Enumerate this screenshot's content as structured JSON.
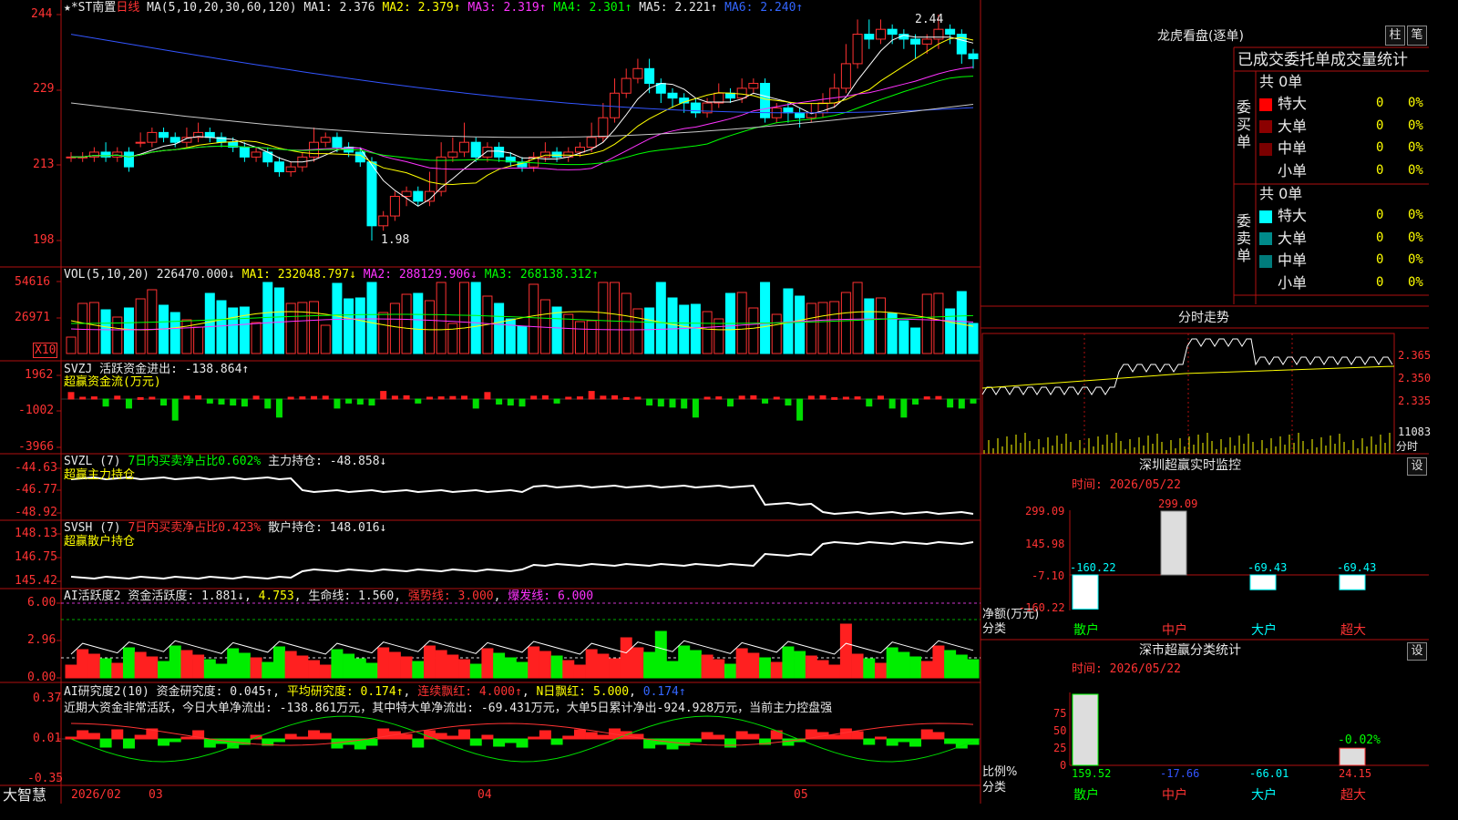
{
  "header": {
    "stock": "★*ST南置",
    "period": "日线",
    "ma_label": "MA(5,10,20,30,60,120)",
    "ma1": "MA1: 2.376",
    "ma2": "MA2: 2.379↑",
    "ma3": "MA3: 2.319↑",
    "ma4": "MA4: 2.301↑",
    "ma5": "MA5: 2.221↑",
    "ma6": "MA6: 2.240↑"
  },
  "price_axis": [
    "244",
    "229",
    "213",
    "198"
  ],
  "price_annotations": {
    "high": "2.44",
    "low": "1.98"
  },
  "volume": {
    "label": "VOL(5,10,20)",
    "value": "226470.000↓",
    "ma1": "MA1: 232048.797↓",
    "ma2": "MA2: 288129.906↓",
    "ma3": "MA3: 268138.312↑",
    "axis": [
      "54616",
      "26971"
    ],
    "unit": "X10"
  },
  "svzj": {
    "label": "SVZJ",
    "value": "活跃资金进出: -138.864↑",
    "subtitle": "超赢资金流(万元)",
    "axis": [
      "1962",
      "-1002",
      "-3966"
    ]
  },
  "svzl": {
    "label": "SVZL (7)",
    "ratio": "7日内买卖净占比0.602%",
    "value": "主力持仓: -48.858↓",
    "subtitle": "超赢主力持仓",
    "axis": [
      "-44.63",
      "-46.77",
      "-48.92"
    ]
  },
  "svsh": {
    "label": "SVSH (7)",
    "ratio": "7日内买卖净占比0.423%",
    "value": "散户持仓: 148.016↓",
    "subtitle": "超赢散户持仓",
    "axis": [
      "148.13",
      "146.75",
      "145.42"
    ]
  },
  "ai_active": {
    "label": "AI活跃度2",
    "v1": "资金活跃度: 1.881↓",
    "v2": "4.753",
    "v3": "生命线: 1.560",
    "v4": "强势线: 3.000",
    "v5": "爆发线: 6.000",
    "axis": [
      "6.00",
      "2.96",
      "0.00"
    ]
  },
  "ai_research": {
    "label": "AI研究度2(10)",
    "v1": "资金研究度: 0.045↑",
    "v2": "平均研究度: 0.174↑",
    "v3": "连续飘红: 4.000↑",
    "v4": "N日飘红: 5.000",
    "v5": "0.174↑",
    "comment": "近期大资金非常活跃，今日大单净流出: -138.861万元，其中特大单净流出: -69.431万元，大单5日累计净出-924.928万元，当前主力控盘强",
    "axis": [
      "0.37",
      "0.01",
      "-0.35"
    ]
  },
  "bottom_bar": {
    "brand": "大智慧",
    "dates": [
      "2026/02",
      "03",
      "04",
      "05"
    ]
  },
  "right_panel": {
    "dragon_title": "龙虎看盘(逐单)",
    "btn1": "柱",
    "btn2": "笔",
    "stat_title": "已成交委托单成交量统计",
    "buy_side": "委买单",
    "sell_side": "委卖单",
    "buy_total": "共 0单",
    "sell_total": "共 0单",
    "buy_rows": [
      {
        "name": "特大",
        "vol": "0",
        "pct": "0%",
        "color": "#ff0000"
      },
      {
        "name": "大单",
        "vol": "0",
        "pct": "0%",
        "color": "#8b0000"
      },
      {
        "name": "中单",
        "vol": "0",
        "pct": "0%",
        "color": "#7a0000"
      },
      {
        "name": "小单",
        "vol": "0",
        "pct": "0%",
        "color": "#000000"
      }
    ],
    "sell_rows": [
      {
        "name": "特大",
        "vol": "0",
        "pct": "0%",
        "color": "#00ffff"
      },
      {
        "name": "大单",
        "vol": "0",
        "pct": "0%",
        "color": "#008b8b"
      },
      {
        "name": "中单",
        "vol": "0",
        "pct": "0%",
        "color": "#007b7b"
      },
      {
        "name": "小单",
        "vol": "0",
        "pct": "0%",
        "color": "#000000"
      }
    ],
    "intraday_title": "分时走势",
    "intraday_axis": [
      "2.365",
      "2.350",
      "2.335"
    ],
    "intraday_vol": "11083",
    "intraday_unit": "分时",
    "sz_monitor": {
      "title": "深圳超赢实时监控",
      "set": "设",
      "time": "时间: 2026/05/22",
      "axis": [
        "299.09",
        "145.98",
        "-7.10",
        "-160.22"
      ],
      "ylabel": "净额(万元)",
      "xlabel": "分类",
      "cats": [
        "散户",
        "中户",
        "大户",
        "超大"
      ],
      "values": [
        -160.22,
        299.09,
        -69.43,
        -69.43
      ]
    },
    "sz_class": {
      "title": "深市超赢分类统计",
      "set": "设",
      "time": "时间: 2026/05/22",
      "axis": [
        "75",
        "50",
        "25",
        "0"
      ],
      "ylabel": "比例%",
      "xlabel": "分类",
      "cats": [
        "散户",
        "中户",
        "大户",
        "超大"
      ],
      "values": [
        159.52,
        -17.66,
        -66.01,
        24.15
      ],
      "note": "-0.02%"
    }
  },
  "chart_data": {
    "type": "candlestick",
    "ylim": [
      1.96,
      2.46
    ],
    "x_labels": [
      "2026/02",
      "03",
      "04",
      "05"
    ],
    "candles": [
      [
        2.15,
        2.15,
        2.16,
        2.14
      ],
      [
        2.15,
        2.15,
        2.16,
        2.14
      ],
      [
        2.15,
        2.16,
        2.17,
        2.14
      ],
      [
        2.16,
        2.15,
        2.18,
        2.14
      ],
      [
        2.15,
        2.16,
        2.17,
        2.14
      ],
      [
        2.16,
        2.13,
        2.17,
        2.12
      ],
      [
        2.18,
        2.18,
        2.2,
        2.17
      ],
      [
        2.18,
        2.2,
        2.21,
        2.17
      ],
      [
        2.2,
        2.19,
        2.21,
        2.18
      ],
      [
        2.19,
        2.18,
        2.2,
        2.17
      ],
      [
        2.18,
        2.19,
        2.21,
        2.17
      ],
      [
        2.19,
        2.2,
        2.22,
        2.18
      ],
      [
        2.2,
        2.19,
        2.21,
        2.18
      ],
      [
        2.19,
        2.18,
        2.2,
        2.17
      ],
      [
        2.18,
        2.17,
        2.19,
        2.16
      ],
      [
        2.17,
        2.15,
        2.18,
        2.14
      ],
      [
        2.15,
        2.16,
        2.17,
        2.14
      ],
      [
        2.16,
        2.14,
        2.17,
        2.13
      ],
      [
        2.14,
        2.12,
        2.15,
        2.11
      ],
      [
        2.12,
        2.13,
        2.14,
        2.11
      ],
      [
        2.13,
        2.15,
        2.16,
        2.12
      ],
      [
        2.15,
        2.18,
        2.21,
        2.14
      ],
      [
        2.18,
        2.19,
        2.2,
        2.17
      ],
      [
        2.19,
        2.17,
        2.2,
        2.16
      ],
      [
        2.17,
        2.16,
        2.18,
        2.15
      ],
      [
        2.16,
        2.14,
        2.17,
        2.13
      ],
      [
        2.14,
        2.01,
        2.15,
        1.98
      ],
      [
        2.01,
        2.03,
        2.04,
        2.0
      ],
      [
        2.03,
        2.07,
        2.08,
        2.02
      ],
      [
        2.07,
        2.08,
        2.09,
        2.05
      ],
      [
        2.08,
        2.06,
        2.09,
        2.05
      ],
      [
        2.06,
        2.08,
        2.12,
        2.05
      ],
      [
        2.08,
        2.15,
        2.18,
        2.07
      ],
      [
        2.15,
        2.16,
        2.19,
        2.14
      ],
      [
        2.16,
        2.18,
        2.22,
        2.15
      ],
      [
        2.18,
        2.15,
        2.19,
        2.14
      ],
      [
        2.15,
        2.17,
        2.18,
        2.14
      ],
      [
        2.17,
        2.15,
        2.18,
        2.14
      ],
      [
        2.15,
        2.14,
        2.16,
        2.13
      ],
      [
        2.14,
        2.13,
        2.15,
        2.12
      ],
      [
        2.13,
        2.15,
        2.16,
        2.12
      ],
      [
        2.15,
        2.16,
        2.18,
        2.14
      ],
      [
        2.16,
        2.15,
        2.17,
        2.14
      ],
      [
        2.15,
        2.16,
        2.17,
        2.14
      ],
      [
        2.16,
        2.17,
        2.18,
        2.15
      ],
      [
        2.17,
        2.19,
        2.22,
        2.16
      ],
      [
        2.19,
        2.23,
        2.26,
        2.18
      ],
      [
        2.23,
        2.28,
        2.31,
        2.22
      ],
      [
        2.28,
        2.31,
        2.33,
        2.27
      ],
      [
        2.31,
        2.33,
        2.35,
        2.3
      ],
      [
        2.33,
        2.3,
        2.35,
        2.28
      ],
      [
        2.3,
        2.28,
        2.31,
        2.26
      ],
      [
        2.28,
        2.27,
        2.29,
        2.25
      ],
      [
        2.27,
        2.26,
        2.28,
        2.24
      ],
      [
        2.26,
        2.24,
        2.27,
        2.23
      ],
      [
        2.24,
        2.26,
        2.27,
        2.23
      ],
      [
        2.26,
        2.28,
        2.3,
        2.25
      ],
      [
        2.28,
        2.27,
        2.29,
        2.26
      ],
      [
        2.27,
        2.29,
        2.31,
        2.26
      ],
      [
        2.29,
        2.3,
        2.31,
        2.28
      ],
      [
        2.3,
        2.23,
        2.31,
        2.22
      ],
      [
        2.23,
        2.25,
        2.26,
        2.22
      ],
      [
        2.25,
        2.24,
        2.26,
        2.22
      ],
      [
        2.24,
        2.23,
        2.25,
        2.21
      ],
      [
        2.23,
        2.24,
        2.26,
        2.22
      ],
      [
        2.24,
        2.26,
        2.28,
        2.23
      ],
      [
        2.26,
        2.29,
        2.32,
        2.25
      ],
      [
        2.29,
        2.34,
        2.38,
        2.28
      ],
      [
        2.34,
        2.4,
        2.43,
        2.33
      ],
      [
        2.4,
        2.39,
        2.43,
        2.37
      ],
      [
        2.39,
        2.41,
        2.43,
        2.38
      ],
      [
        2.41,
        2.4,
        2.42,
        2.38
      ],
      [
        2.4,
        2.39,
        2.41,
        2.37
      ],
      [
        2.39,
        2.38,
        2.4,
        2.35
      ],
      [
        2.38,
        2.39,
        2.4,
        2.36
      ],
      [
        2.39,
        2.41,
        2.44,
        2.37
      ],
      [
        2.41,
        2.4,
        2.42,
        2.38
      ],
      [
        2.4,
        2.36,
        2.41,
        2.34
      ],
      [
        2.36,
        2.35,
        2.37,
        2.33
      ]
    ]
  }
}
